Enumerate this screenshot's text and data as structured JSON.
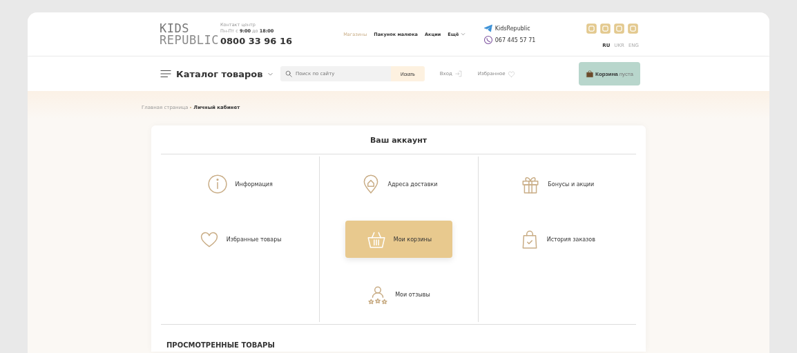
{
  "header": {
    "logo": [
      "KIDS",
      "REPUBLIC"
    ],
    "contact": {
      "label": "Контакт центр",
      "hours": "Пн-Пт с **9:00** до **18:00**",
      "phone": "0800 33 96 16"
    },
    "nav": [
      {
        "label": "Магазины",
        "selected": true
      },
      {
        "label": "Пакунок малюка",
        "selected": false
      },
      {
        "label": "Акции",
        "selected": false
      },
      {
        "label": "Ещё",
        "selected": false
      }
    ],
    "telegram": "KidsRepublic",
    "viber": "067 445 57 71",
    "languages": [
      {
        "label": "RU",
        "selected": true
      },
      {
        "label": "UKR",
        "selected": false
      },
      {
        "label": "ENG",
        "selected": false
      }
    ]
  },
  "toolbar": {
    "catalog": "Каталог товаров",
    "search": {
      "placeholder": "Поиск по сайту",
      "button": "Искать"
    },
    "login": "Вход",
    "favorites": "Избранное",
    "cart": {
      "label": "Корзина",
      "status": "пуста"
    }
  },
  "breadcrumbs": [
    {
      "label": "Главная страница"
    },
    {
      "label": "Личный кабинет"
    }
  ],
  "account": {
    "title": "Ваш аккаунт",
    "items": [
      {
        "kind": "info",
        "label": "Информация",
        "selected": false
      },
      {
        "kind": "pin",
        "label": "Адреса доставки",
        "selected": false
      },
      {
        "kind": "gift",
        "label": "Бонусы и акции",
        "selected": false
      },
      {
        "kind": "heart",
        "label": "Избранные товары",
        "selected": false
      },
      {
        "kind": "basket",
        "label": "Мои корзины",
        "selected": true
      },
      {
        "kind": "bag",
        "label": "История заказов",
        "selected": false
      },
      {
        "kind": "reviews",
        "label": "Мои отзывы",
        "selected": false
      }
    ]
  },
  "viewed": {
    "title": "ПРОСМОТРЕННЫЕ ТОВАРЫ"
  }
}
